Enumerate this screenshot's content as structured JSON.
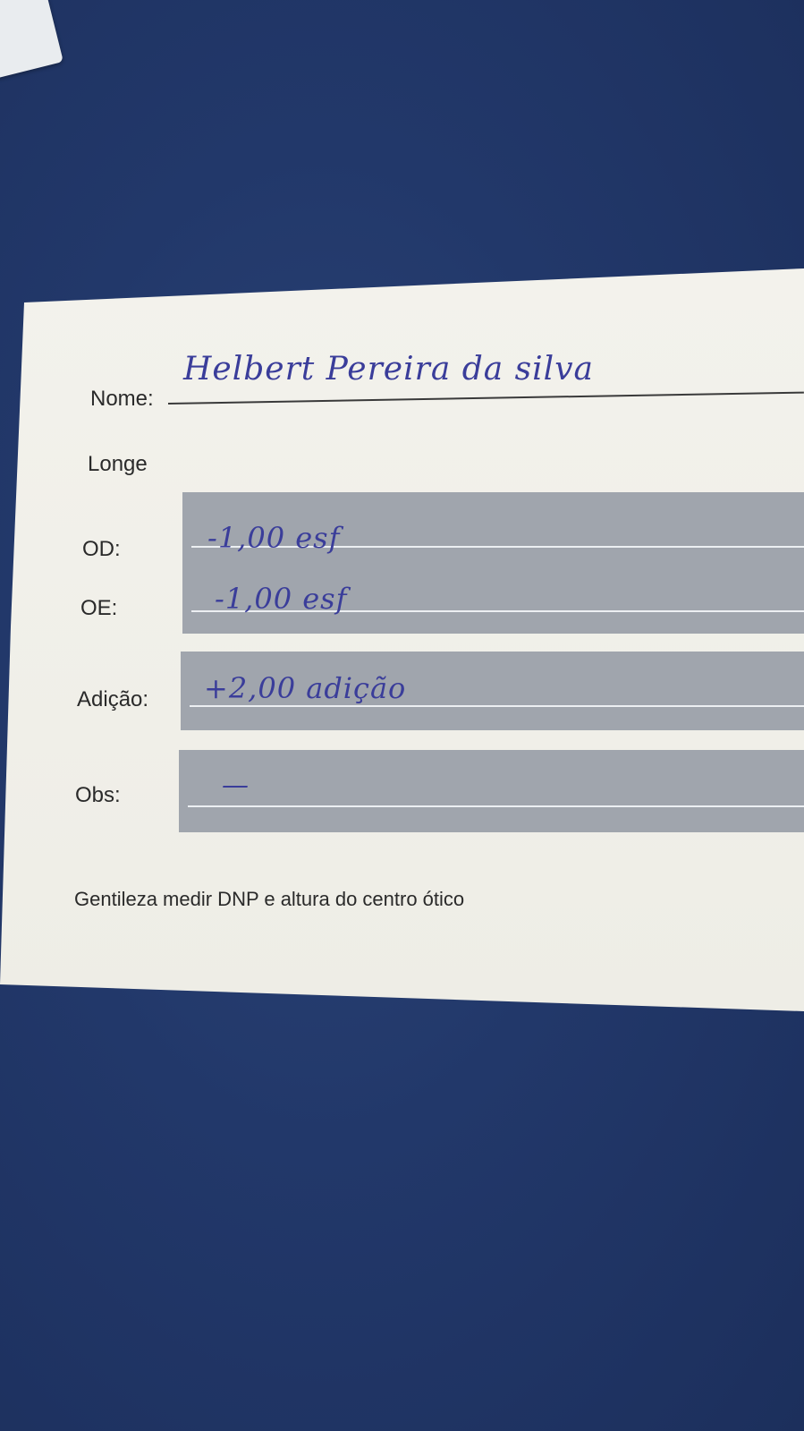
{
  "card": {
    "nome_label": "Nome:",
    "nome_value": "Helbert Pereira da silva",
    "longe_label": "Longe",
    "od_label": "OD:",
    "od_value": "-1,00 esf",
    "oe_label": "OE:",
    "oe_value": "-1,00 esf",
    "adicao_label": "Adição:",
    "adicao_value": "+2,00 adição",
    "obs_label": "Obs:",
    "obs_value": "—",
    "footer": "Gentileza medir DNP e altura do centro ótico"
  },
  "colors": {
    "background": "#22386a",
    "card": "#f1f0ea",
    "band": "#a0a5ad",
    "ink": "#3a3d9a"
  }
}
